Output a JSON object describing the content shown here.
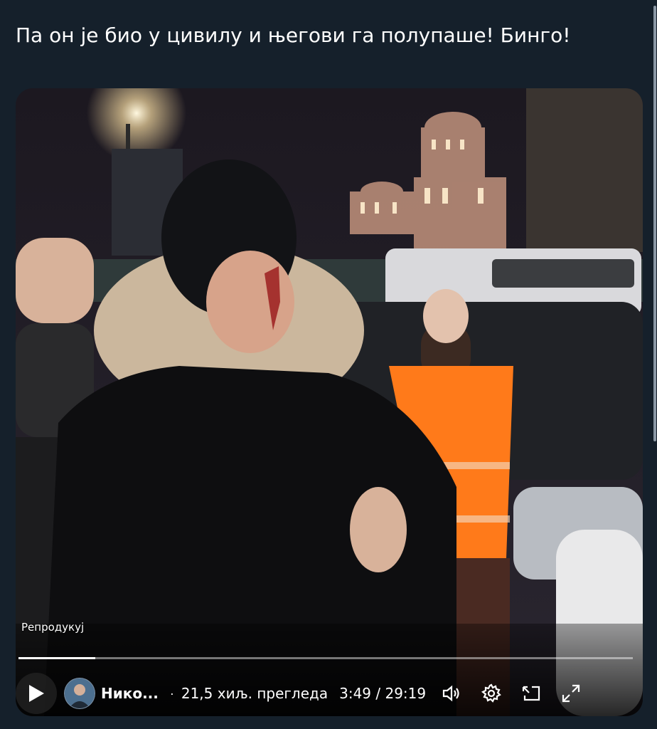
{
  "tweet": {
    "text": "Па он је био у цивилу и његови га полупаше! Бинго!"
  },
  "video": {
    "replay_label": "Репродукуј",
    "progress_fraction": 0.125,
    "author": "Нико...",
    "separator": "·",
    "views": "21,5 хиљ. прегледа",
    "time": "3:49 / 29:19"
  },
  "icons": {
    "play": "play-icon",
    "volume": "volume-icon",
    "settings": "gear-icon",
    "pip": "picture-in-picture-icon",
    "fullscreen": "fullscreen-icon"
  },
  "colors": {
    "background": "#15202b",
    "vest": "#ff7a1a"
  }
}
